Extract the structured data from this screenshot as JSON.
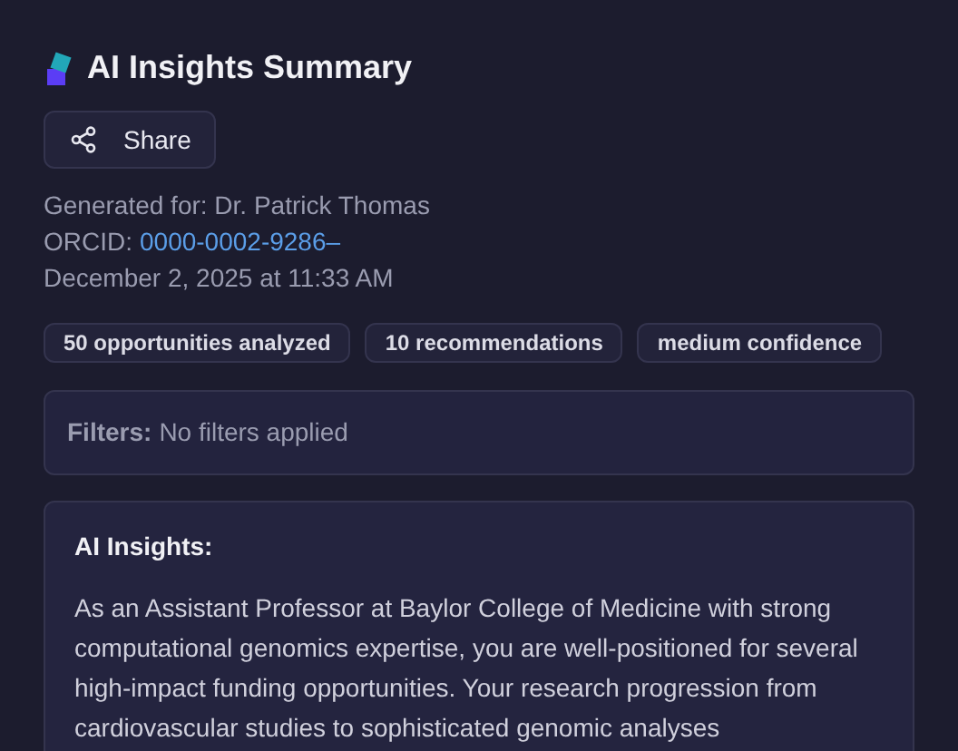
{
  "title": "AI Insights Summary",
  "share_button": {
    "label": "Share"
  },
  "meta": {
    "generated_for": "Generated for: Dr. Patrick Thomas",
    "orcid_label": "ORCID:",
    "orcid_link": "0000-0002-9286–",
    "date": "December 2, 2025 at 11:33 AM"
  },
  "badges": [
    "50 opportunities analyzed",
    "10 recommendations",
    "medium confidence"
  ],
  "filters": {
    "label": "Filters:",
    "value": "No filters applied"
  },
  "insights": {
    "heading": "AI Insights:",
    "body": "As an Assistant Professor at Baylor College of Medicine with strong computational genomics expertise, you are well-positioned for several high-impact funding opportunities. Your research progression from cardiovascular studies to sophisticated genomic analyses"
  }
}
